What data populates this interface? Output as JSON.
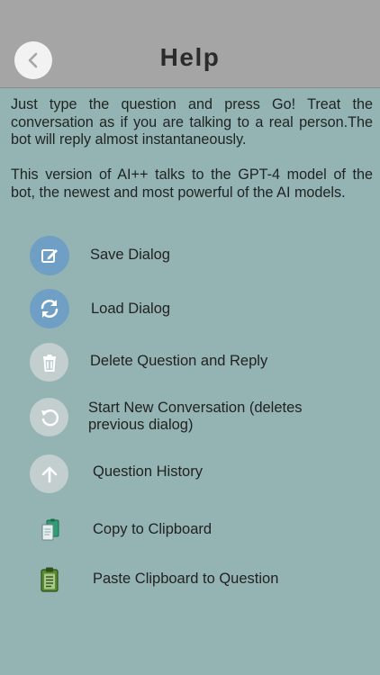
{
  "header": {
    "title": "Help"
  },
  "intro": {
    "paragraph1": "Just type the question and press Go! Treat the conversation as if you are talking to a real person.The bot will reply almost instantaneously.",
    "paragraph2": "This version  of AI++  talks to the GPT-4  model of the bot, the newest and most powerful of  the AI models."
  },
  "items": [
    {
      "label": "Save Dialog",
      "icon": "edit-icon"
    },
    {
      "label": "Load Dialog",
      "icon": "refresh-icon"
    },
    {
      "label": "Delete Question and Reply",
      "icon": "trash-icon"
    },
    {
      "label": "Start New Conversation (deletes previous dialog)",
      "icon": "restart-icon"
    },
    {
      "label": "Question  History",
      "icon": "arrow-up-icon"
    },
    {
      "label": "Copy  to Clipboard",
      "icon": "copy-icon"
    },
    {
      "label": "Paste  Clipboard to Question",
      "icon": "paste-icon"
    }
  ],
  "colors": {
    "background": "#94b4b3",
    "header": "#a5a5a5",
    "accent_blue": "#6f9fc4",
    "circle_grey": "#c3cfcf"
  }
}
